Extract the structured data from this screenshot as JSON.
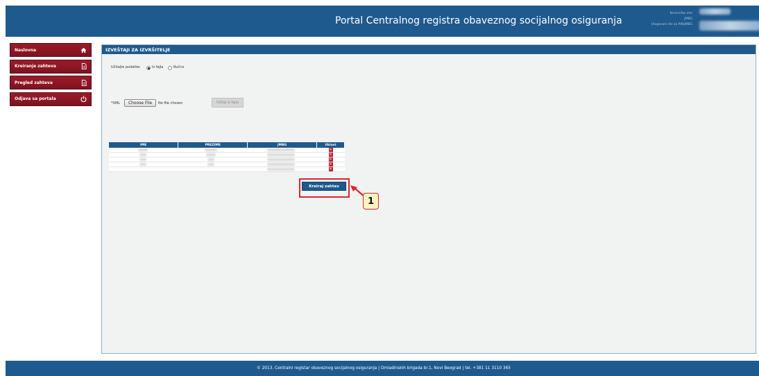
{
  "header": {
    "title": "Portal Centralnog registra obaveznog socijalnog osiguranja",
    "user_label": "Korisničko ime",
    "jmbg_label": "JMBG",
    "pib_label": "Ulogovani ste za PIB/JMBG"
  },
  "sidebar": {
    "items": [
      {
        "label": "Naslovna",
        "icon": "home-icon"
      },
      {
        "label": "Kreiranje zahteva",
        "icon": "document-icon"
      },
      {
        "label": "Pregled zahteva",
        "icon": "document-icon"
      },
      {
        "label": "Odjava sa portala",
        "icon": "power-icon"
      }
    ]
  },
  "panel": {
    "title": "IZVEŠTAJI ZA IZVRŠITELJE",
    "load_data_label": "Učitajte podatke:",
    "option_file": "Iz fajla",
    "option_manual": "Ručno",
    "xml_label": "*XML",
    "choose_file_label": "Choose File",
    "no_file_label": "No file chosen",
    "load_from_file_label": "Učitaj iz fajla"
  },
  "table": {
    "headers": [
      "IME",
      "PREZIME",
      "JMBG",
      "Ukloni"
    ],
    "row_count": 5
  },
  "actions": {
    "create_request_label": "Kreiraj zahtev"
  },
  "annotation": {
    "callout_number": "1"
  },
  "footer": {
    "text": "© 2013. Centralni registar obaveznog socijalnog osiguranja | Omladinskih brigada br.1, Novi Beograd | tel. +381 11 3110 365"
  },
  "colors": {
    "primary_blue": "#1f5a8e",
    "sidebar_red": "#8b1624",
    "highlight_red": "#d9262e"
  }
}
